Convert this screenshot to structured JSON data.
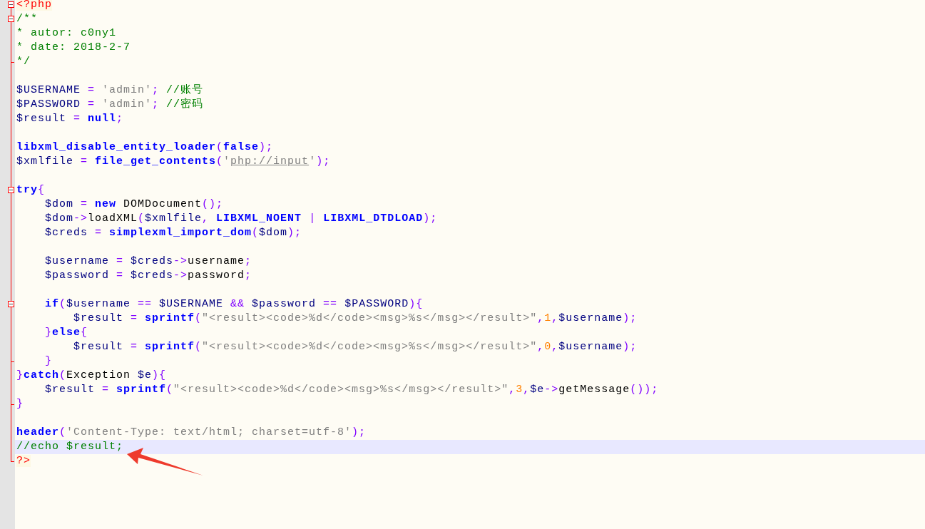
{
  "editor": {
    "lines": [
      {
        "fold_start": true,
        "fold_end": false,
        "current": false,
        "tokens": [
          {
            "kind": "tag",
            "text": "<?php"
          }
        ]
      },
      {
        "fold_start": true,
        "fold_end": false,
        "current": false,
        "tokens": [
          {
            "kind": "comment",
            "text": "/**"
          }
        ]
      },
      {
        "fold_start": false,
        "fold_end": false,
        "current": false,
        "tokens": [
          {
            "kind": "comment",
            "text": "* autor: c0ny1"
          }
        ]
      },
      {
        "fold_start": false,
        "fold_end": false,
        "current": false,
        "tokens": [
          {
            "kind": "comment",
            "text": "* date: 2018-2-7"
          }
        ]
      },
      {
        "fold_start": false,
        "fold_end": true,
        "current": false,
        "tokens": [
          {
            "kind": "comment",
            "text": "*/"
          }
        ]
      },
      {
        "fold_start": false,
        "fold_end": false,
        "current": false
      },
      {
        "fold_start": false,
        "fold_end": false,
        "current": false,
        "tokens": [
          {
            "kind": "var",
            "text": "$USERNAME"
          },
          {
            "kind": "op",
            "text": " = "
          },
          {
            "kind": "string",
            "text": "'admin'"
          },
          {
            "kind": "op",
            "text": "; "
          },
          {
            "kind": "comment",
            "text": "//账号"
          }
        ]
      },
      {
        "fold_start": false,
        "fold_end": false,
        "current": false,
        "tokens": [
          {
            "kind": "var",
            "text": "$PASSWORD"
          },
          {
            "kind": "op",
            "text": " = "
          },
          {
            "kind": "string",
            "text": "'admin'"
          },
          {
            "kind": "op",
            "text": "; "
          },
          {
            "kind": "comment",
            "text": "//密码"
          }
        ]
      },
      {
        "fold_start": false,
        "fold_end": false,
        "current": false,
        "tokens": [
          {
            "kind": "var",
            "text": "$result"
          },
          {
            "kind": "op",
            "text": " = "
          },
          {
            "kind": "keyword",
            "text": "null"
          },
          {
            "kind": "op",
            "text": ";"
          }
        ]
      },
      {
        "fold_start": false,
        "fold_end": false,
        "current": false
      },
      {
        "fold_start": false,
        "fold_end": false,
        "current": false,
        "tokens": [
          {
            "kind": "keyword",
            "text": "libxml_disable_entity_loader"
          },
          {
            "kind": "op",
            "text": "("
          },
          {
            "kind": "keyword",
            "text": "false"
          },
          {
            "kind": "op",
            "text": ");"
          }
        ]
      },
      {
        "fold_start": false,
        "fold_end": false,
        "current": false,
        "tokens": [
          {
            "kind": "var",
            "text": "$xmlfile"
          },
          {
            "kind": "op",
            "text": " = "
          },
          {
            "kind": "keyword",
            "text": "file_get_contents"
          },
          {
            "kind": "op",
            "text": "("
          },
          {
            "kind": "string",
            "text": "'"
          },
          {
            "kind": "link",
            "text": "php://input"
          },
          {
            "kind": "string",
            "text": "'"
          },
          {
            "kind": "op",
            "text": ");"
          }
        ]
      },
      {
        "fold_start": false,
        "fold_end": false,
        "current": false
      },
      {
        "fold_start": true,
        "fold_end": false,
        "current": false,
        "tokens": [
          {
            "kind": "keyword",
            "text": "try"
          },
          {
            "kind": "op",
            "text": "{"
          }
        ]
      },
      {
        "fold_start": false,
        "fold_end": false,
        "current": false,
        "tokens": [
          {
            "kind": "var",
            "text": "    $dom"
          },
          {
            "kind": "op",
            "text": " = "
          },
          {
            "kind": "keyword",
            "text": "new"
          },
          {
            "kind": "plain",
            "text": " DOMDocument"
          },
          {
            "kind": "op",
            "text": "();"
          }
        ]
      },
      {
        "fold_start": false,
        "fold_end": false,
        "current": false,
        "tokens": [
          {
            "kind": "var",
            "text": "    $dom"
          },
          {
            "kind": "op",
            "text": "->"
          },
          {
            "kind": "plain",
            "text": "loadXML"
          },
          {
            "kind": "op",
            "text": "("
          },
          {
            "kind": "var",
            "text": "$xmlfile"
          },
          {
            "kind": "op",
            "text": ", "
          },
          {
            "kind": "keyword",
            "text": "LIBXML_NOENT"
          },
          {
            "kind": "op",
            "text": " | "
          },
          {
            "kind": "keyword",
            "text": "LIBXML_DTDLOAD"
          },
          {
            "kind": "op",
            "text": ");"
          }
        ]
      },
      {
        "fold_start": false,
        "fold_end": false,
        "current": false,
        "tokens": [
          {
            "kind": "var",
            "text": "    $creds"
          },
          {
            "kind": "op",
            "text": " = "
          },
          {
            "kind": "keyword",
            "text": "simplexml_import_dom"
          },
          {
            "kind": "op",
            "text": "("
          },
          {
            "kind": "var",
            "text": "$dom"
          },
          {
            "kind": "op",
            "text": ");"
          }
        ]
      },
      {
        "fold_start": false,
        "fold_end": false,
        "current": false
      },
      {
        "fold_start": false,
        "fold_end": false,
        "current": false,
        "tokens": [
          {
            "kind": "var",
            "text": "    $username"
          },
          {
            "kind": "op",
            "text": " = "
          },
          {
            "kind": "var",
            "text": "$creds"
          },
          {
            "kind": "op",
            "text": "->"
          },
          {
            "kind": "plain",
            "text": "username"
          },
          {
            "kind": "op",
            "text": ";"
          }
        ]
      },
      {
        "fold_start": false,
        "fold_end": false,
        "current": false,
        "tokens": [
          {
            "kind": "var",
            "text": "    $password"
          },
          {
            "kind": "op",
            "text": " = "
          },
          {
            "kind": "var",
            "text": "$creds"
          },
          {
            "kind": "op",
            "text": "->"
          },
          {
            "kind": "plain",
            "text": "password"
          },
          {
            "kind": "op",
            "text": ";"
          }
        ]
      },
      {
        "fold_start": false,
        "fold_end": false,
        "current": false
      },
      {
        "fold_start": true,
        "fold_end": false,
        "current": false,
        "tokens": [
          {
            "kind": "keyword",
            "text": "    if"
          },
          {
            "kind": "op",
            "text": "("
          },
          {
            "kind": "var",
            "text": "$username"
          },
          {
            "kind": "op",
            "text": " == "
          },
          {
            "kind": "var",
            "text": "$USERNAME"
          },
          {
            "kind": "op",
            "text": " && "
          },
          {
            "kind": "var",
            "text": "$password"
          },
          {
            "kind": "op",
            "text": " == "
          },
          {
            "kind": "var",
            "text": "$PASSWORD"
          },
          {
            "kind": "op",
            "text": "){"
          }
        ]
      },
      {
        "fold_start": false,
        "fold_end": false,
        "current": false,
        "tokens": [
          {
            "kind": "var",
            "text": "        $result"
          },
          {
            "kind": "op",
            "text": " = "
          },
          {
            "kind": "keyword",
            "text": "sprintf"
          },
          {
            "kind": "op",
            "text": "("
          },
          {
            "kind": "string",
            "text": "\"<result><code>%d</code><msg>%s</msg></result>\""
          },
          {
            "kind": "op",
            "text": ","
          },
          {
            "kind": "number",
            "text": "1"
          },
          {
            "kind": "op",
            "text": ","
          },
          {
            "kind": "var",
            "text": "$username"
          },
          {
            "kind": "op",
            "text": ");"
          }
        ]
      },
      {
        "fold_start": false,
        "fold_end": false,
        "current": false,
        "tokens": [
          {
            "kind": "op",
            "text": "    }"
          },
          {
            "kind": "keyword",
            "text": "else"
          },
          {
            "kind": "op",
            "text": "{"
          }
        ]
      },
      {
        "fold_start": false,
        "fold_end": false,
        "current": false,
        "tokens": [
          {
            "kind": "var",
            "text": "        $result"
          },
          {
            "kind": "op",
            "text": " = "
          },
          {
            "kind": "keyword",
            "text": "sprintf"
          },
          {
            "kind": "op",
            "text": "("
          },
          {
            "kind": "string",
            "text": "\"<result><code>%d</code><msg>%s</msg></result>\""
          },
          {
            "kind": "op",
            "text": ","
          },
          {
            "kind": "number",
            "text": "0"
          },
          {
            "kind": "op",
            "text": ","
          },
          {
            "kind": "var",
            "text": "$username"
          },
          {
            "kind": "op",
            "text": ");"
          }
        ]
      },
      {
        "fold_start": false,
        "fold_end": true,
        "current": false,
        "tokens": [
          {
            "kind": "op",
            "text": "    }"
          }
        ]
      },
      {
        "fold_start": false,
        "fold_end": false,
        "current": false,
        "tokens": [
          {
            "kind": "op",
            "text": "}"
          },
          {
            "kind": "keyword",
            "text": "catch"
          },
          {
            "kind": "op",
            "text": "("
          },
          {
            "kind": "plain",
            "text": "Exception "
          },
          {
            "kind": "var",
            "text": "$e"
          },
          {
            "kind": "op",
            "text": "){"
          }
        ]
      },
      {
        "fold_start": false,
        "fold_end": false,
        "current": false,
        "tokens": [
          {
            "kind": "var",
            "text": "    $result"
          },
          {
            "kind": "op",
            "text": " = "
          },
          {
            "kind": "keyword",
            "text": "sprintf"
          },
          {
            "kind": "op",
            "text": "("
          },
          {
            "kind": "string",
            "text": "\"<result><code>%d</code><msg>%s</msg></result>\""
          },
          {
            "kind": "op",
            "text": ","
          },
          {
            "kind": "number",
            "text": "3"
          },
          {
            "kind": "op",
            "text": ","
          },
          {
            "kind": "var",
            "text": "$e"
          },
          {
            "kind": "op",
            "text": "->"
          },
          {
            "kind": "plain",
            "text": "getMessage"
          },
          {
            "kind": "op",
            "text": "());"
          }
        ]
      },
      {
        "fold_start": false,
        "fold_end": true,
        "current": false,
        "tokens": [
          {
            "kind": "op",
            "text": "}"
          }
        ]
      },
      {
        "fold_start": false,
        "fold_end": false,
        "current": false
      },
      {
        "fold_start": false,
        "fold_end": false,
        "current": false,
        "tokens": [
          {
            "kind": "keyword",
            "text": "header"
          },
          {
            "kind": "op",
            "text": "("
          },
          {
            "kind": "string",
            "text": "'Content-Type: text/html; charset=utf-8'"
          },
          {
            "kind": "op",
            "text": ");"
          }
        ]
      },
      {
        "fold_start": false,
        "fold_end": false,
        "current": true,
        "tokens": [
          {
            "kind": "comment",
            "text": "//echo $result;"
          }
        ]
      },
      {
        "fold_start": false,
        "fold_end": true,
        "current": false,
        "tokens": [
          {
            "kind": "tag",
            "text": "?>"
          }
        ]
      }
    ]
  }
}
